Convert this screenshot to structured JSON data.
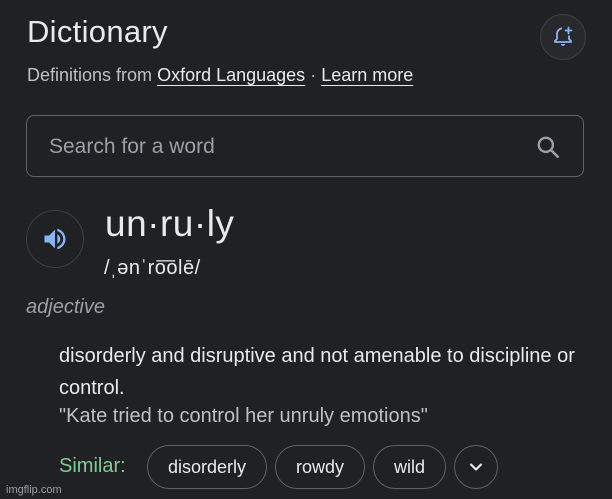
{
  "header": {
    "title": "Dictionary",
    "subtitle_prefix": "Definitions from",
    "source_link": "Oxford Languages",
    "separator": "·",
    "learn_more": "Learn more",
    "bell_icon": "bell-plus-icon"
  },
  "search": {
    "placeholder": "Search for a word",
    "value": "",
    "icon": "search-icon"
  },
  "entry": {
    "speaker_icon": "speaker-icon",
    "headword": "un·ru·ly",
    "phonetic": "/ˌənˈro͞olē/",
    "part_of_speech": "adjective",
    "definition": "disorderly and disruptive and not amenable to discipline or control.",
    "example": "\"Kate tried to control her unruly emotions\"",
    "similar_label": "Similar:",
    "similar": [
      "disorderly",
      "rowdy",
      "wild"
    ],
    "expand_icon": "chevron-down-icon"
  },
  "watermark": "imgflip.com",
  "colors": {
    "background": "#202124",
    "text": "#e8eaed",
    "muted": "#9aa0a6",
    "accent_blue": "#8ab4f8",
    "similar_green": "#81c995"
  }
}
